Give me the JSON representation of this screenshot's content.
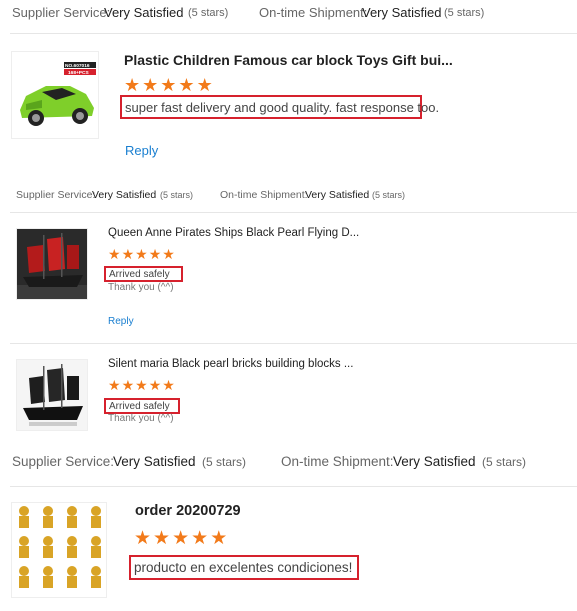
{
  "rating_rows": [
    {
      "supplier_label": "Supplier Service:",
      "supplier_value": "Very Satisfied",
      "supplier_stars": "(5 stars)",
      "shipment_label": "On-time Shipment:",
      "shipment_value": "Very Satisfied",
      "shipment_stars": "(5 stars)"
    },
    {
      "supplier_label": "Supplier Service:",
      "supplier_value": "Very Satisfied",
      "supplier_stars": "(5 stars)",
      "shipment_label": "On-time Shipment:",
      "shipment_value": "Very Satisfied",
      "shipment_stars": "(5 stars)"
    },
    {
      "supplier_label": "Supplier Service:",
      "supplier_value": "Very Satisfied",
      "supplier_stars": "(5 stars)",
      "shipment_label": "On-time Shipment:",
      "shipment_value": "Very Satisfied",
      "shipment_stars": "(5 stars)"
    }
  ],
  "reviews": [
    {
      "title": "Plastic Children Famous car block Toys Gift bui...",
      "rating": 5,
      "comment": "super fast delivery and good quality. fast response too.",
      "reply": "Reply",
      "thumb_badge": "NO.607016",
      "thumb_badge2": "168+PCS"
    },
    {
      "title": "Queen Anne Pirates Ships Black Pearl Flying D...",
      "rating": 5,
      "comment": "Arrived safely",
      "thanks": "Thank you (^^)",
      "reply": "Reply"
    },
    {
      "title": "Silent maria Black pearl bricks building blocks ...",
      "rating": 5,
      "comment": "Arrived safely",
      "thanks": "Thank you (^^)"
    },
    {
      "title": "order 20200729",
      "rating": 5,
      "comment": "producto en excelentes condiciones!"
    }
  ],
  "colors": {
    "star": "#f27a1a",
    "highlight_border": "#d6212d",
    "reply_link": "#1a7fd0"
  },
  "icons": {
    "star": "star-icon"
  }
}
